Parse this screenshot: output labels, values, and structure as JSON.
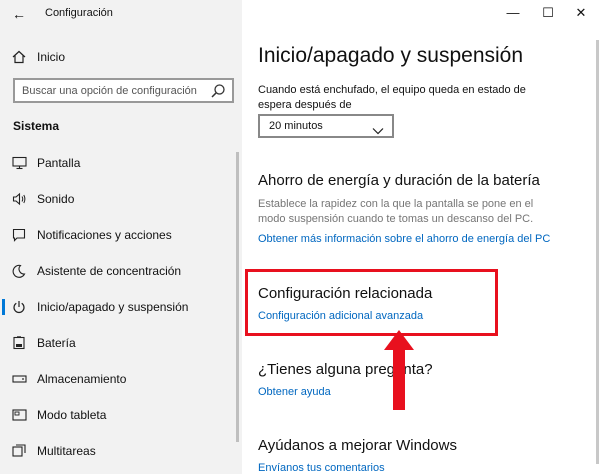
{
  "window": {
    "title": "Configuración",
    "controls": {
      "minimize": "—",
      "maximize": "☐",
      "close": "✕",
      "back": "←"
    }
  },
  "sidebar": {
    "home_label": "Inicio",
    "search": {
      "placeholder": "Buscar una opción de configuración"
    },
    "section_title": "Sistema",
    "items": [
      {
        "label": "Pantalla",
        "icon": "display-icon",
        "active": false
      },
      {
        "label": "Sonido",
        "icon": "speaker-icon",
        "active": false
      },
      {
        "label": "Notificaciones y acciones",
        "icon": "notifications-icon",
        "active": false
      },
      {
        "label": "Asistente de concentración",
        "icon": "moon-icon",
        "active": false
      },
      {
        "label": "Inicio/apagado y suspensión",
        "icon": "power-icon",
        "active": true
      },
      {
        "label": "Batería",
        "icon": "battery-icon",
        "active": false
      },
      {
        "label": "Almacenamiento",
        "icon": "storage-icon",
        "active": false
      },
      {
        "label": "Modo tableta",
        "icon": "tablet-icon",
        "active": false
      },
      {
        "label": "Multitareas",
        "icon": "multitask-icon",
        "active": false
      }
    ]
  },
  "main": {
    "page_title": "Inicio/apagado y suspensión",
    "plugged_text": "Cuando está enchufado, el equipo queda en estado de espera después de",
    "sleep_select_value": "20 minutos",
    "battery": {
      "heading": "Ahorro de energía y duración de la batería",
      "description": "Establece la rapidez con la que la pantalla se pone en el modo suspensión cuando te tomas un descanso del PC.",
      "link": "Obtener más información sobre el ahorro de energía del PC"
    },
    "related": {
      "heading": "Configuración relacionada",
      "link": "Configuración adicional avanzada"
    },
    "question": {
      "heading": "¿Tienes alguna pregunta?",
      "link": "Obtener ayuda"
    },
    "improve": {
      "heading": "Ayúdanos a mejorar Windows",
      "link": "Envíanos tus comentarios"
    }
  },
  "colors": {
    "accent": "#0078d7",
    "link": "#0067c0",
    "annotation": "#e8101e",
    "sidebar_bg": "#f2f2f2"
  }
}
